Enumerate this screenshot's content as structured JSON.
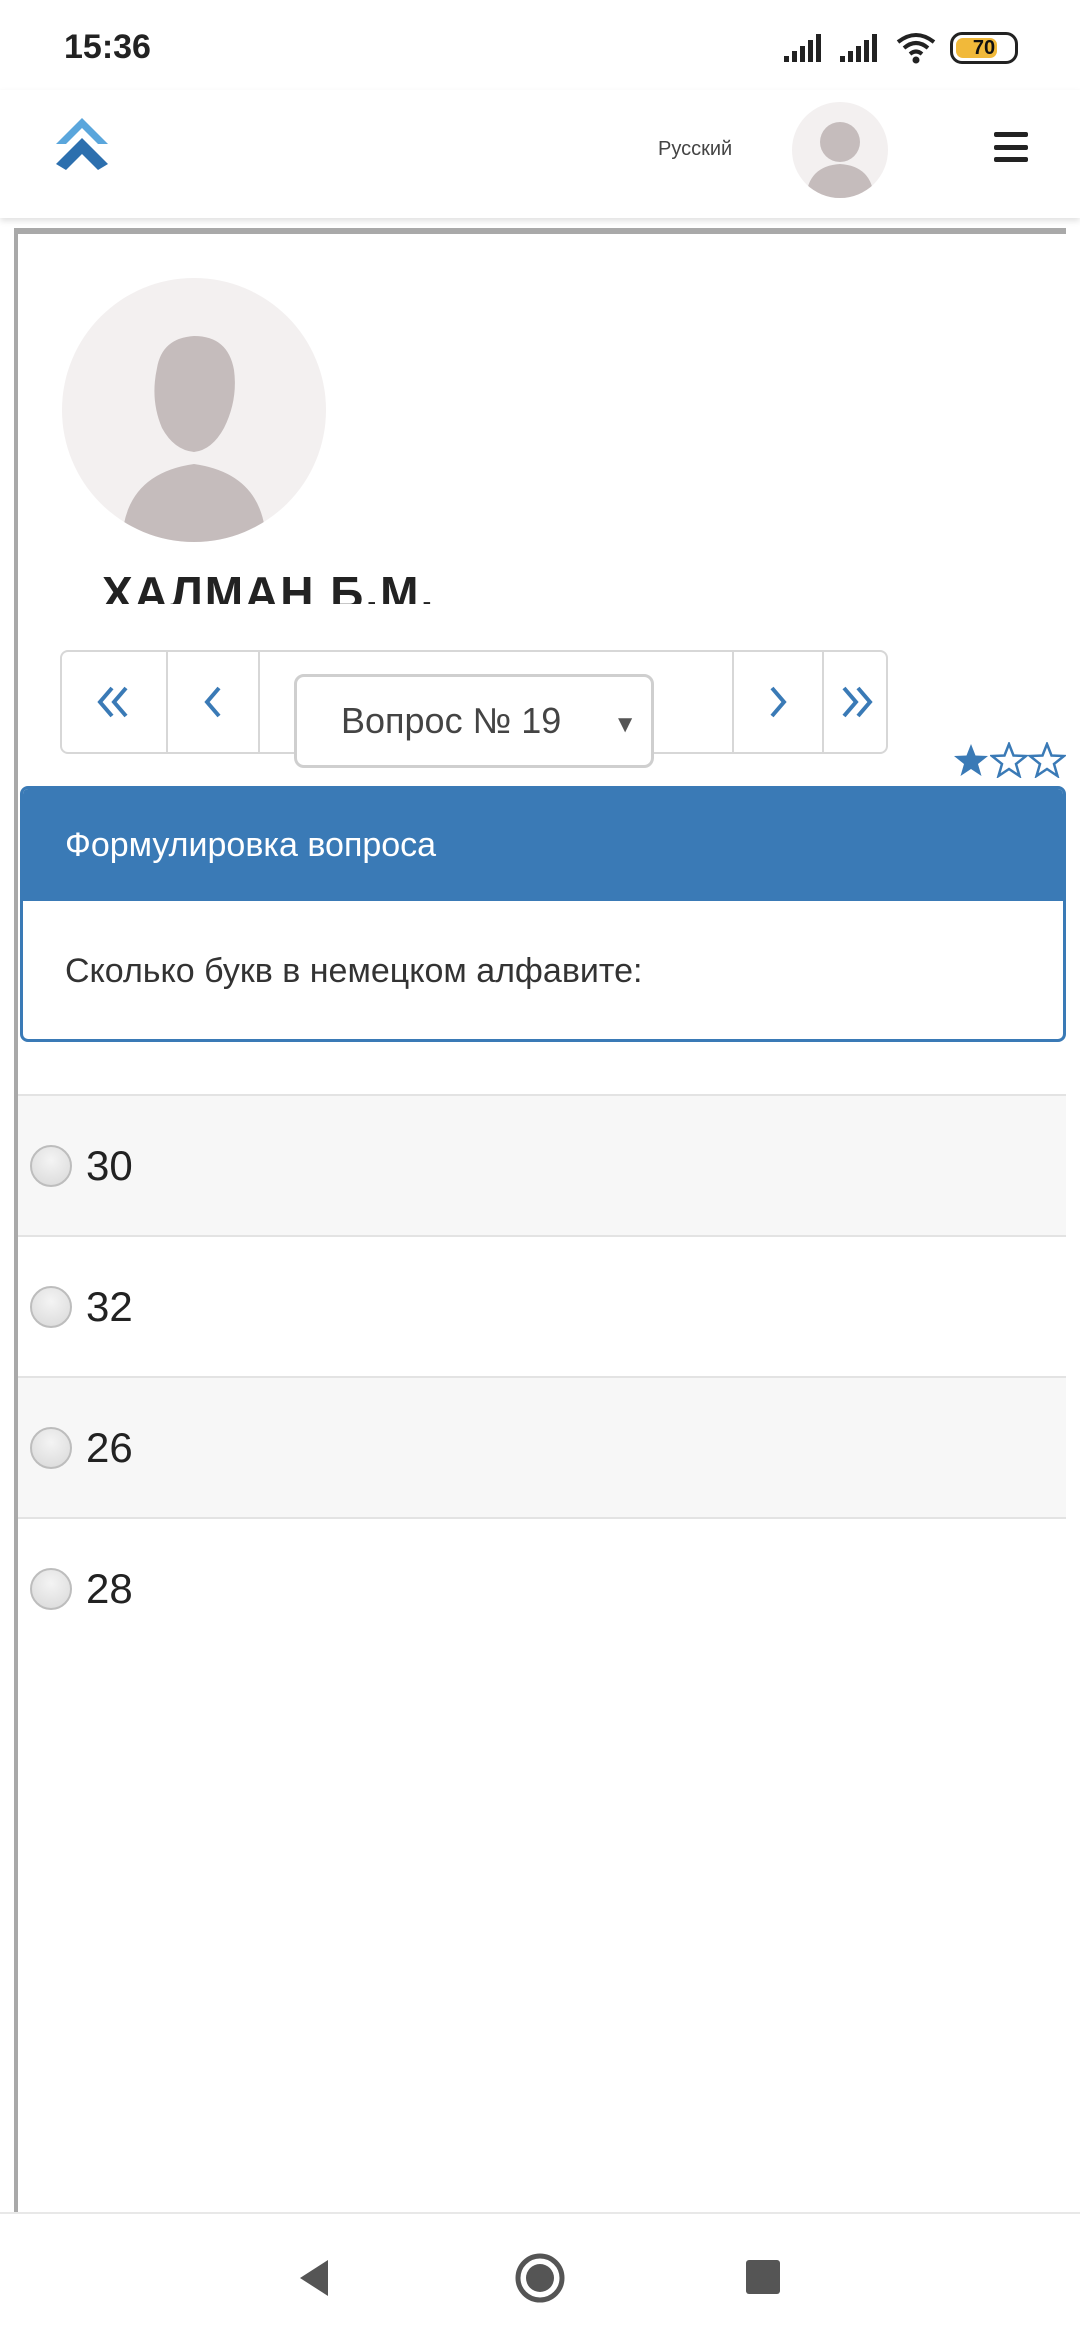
{
  "status_bar": {
    "time": "15:36",
    "battery_level": "70",
    "icons": [
      "signal-icon",
      "signal-icon",
      "wifi-icon",
      "battery-icon"
    ]
  },
  "header": {
    "language": "Русский",
    "icons": [
      "logo-icon",
      "avatar",
      "hamburger-menu-icon"
    ]
  },
  "profile": {
    "name": "ХАЛМАН Б.М."
  },
  "pager": {
    "question_select": "Вопрос № 19",
    "icons": [
      "double-chevron-left-icon",
      "chevron-left-icon",
      "chevron-right-icon",
      "double-chevron-right-icon"
    ]
  },
  "rating": {
    "filled": 1,
    "total": 3,
    "accent": "#3a7ab6"
  },
  "question": {
    "header": "Формулировка вопроса",
    "text": "Сколько букв в немецком алфавите:"
  },
  "answers": [
    {
      "label": "30"
    },
    {
      "label": "32"
    },
    {
      "label": "26"
    },
    {
      "label": "28"
    }
  ],
  "colors": {
    "accent": "#3a7ab6",
    "battery": "#f1b93a"
  },
  "nav_bar": {
    "icons": [
      "back-icon",
      "home-icon",
      "recent-apps-icon"
    ]
  }
}
